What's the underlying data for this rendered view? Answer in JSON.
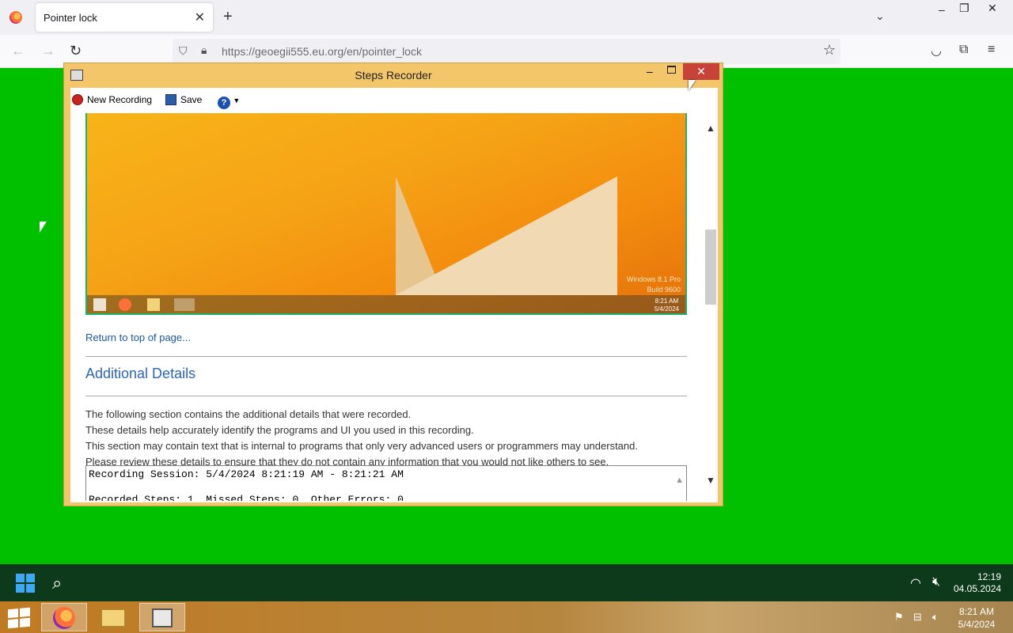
{
  "browser": {
    "tab_title": "Pointer lock",
    "tab_close": "✕",
    "new_tab": "+",
    "url_host": "https://geoegii555.eu.org",
    "url_path": "/en/pointer_lock"
  },
  "steps_recorder": {
    "title": "Steps Recorder",
    "close": "✕",
    "toolbar": {
      "new_recording": "New Recording",
      "save": "Save",
      "help": "?"
    },
    "screenshot": {
      "watermark_line1": "Windows 8.1 Pro",
      "watermark_line2": "Build 9600",
      "clock_time": "8:21 AM",
      "clock_date": "5/4/2024"
    },
    "return_link": "Return to top of page...",
    "heading": "Additional Details",
    "paragraphs": [
      "The following section contains the additional details that were recorded.",
      "These details help accurately identify the programs and UI you used in this recording.",
      "This section may contain text that is internal to programs that only very advanced users or programmers may understand.",
      "Please review these details to ensure that they do not contain any information that you would not like others to see."
    ],
    "details_line1": "Recording Session: 5/4/2024 8:21:19 AM - 8:21:21 AM",
    "details_line2": "Recorded Steps: 1, Missed Steps: 0, Other Errors: 0"
  },
  "taskbar_top": {
    "time": "12:19",
    "date": "04.05.2024"
  },
  "taskbar_bottom": {
    "time": "8:21 AM",
    "date": "5/4/2024"
  },
  "colors": {
    "desktop": "#00c000",
    "recorder_frame": "#f4c66a",
    "close_button": "#c7433a"
  }
}
